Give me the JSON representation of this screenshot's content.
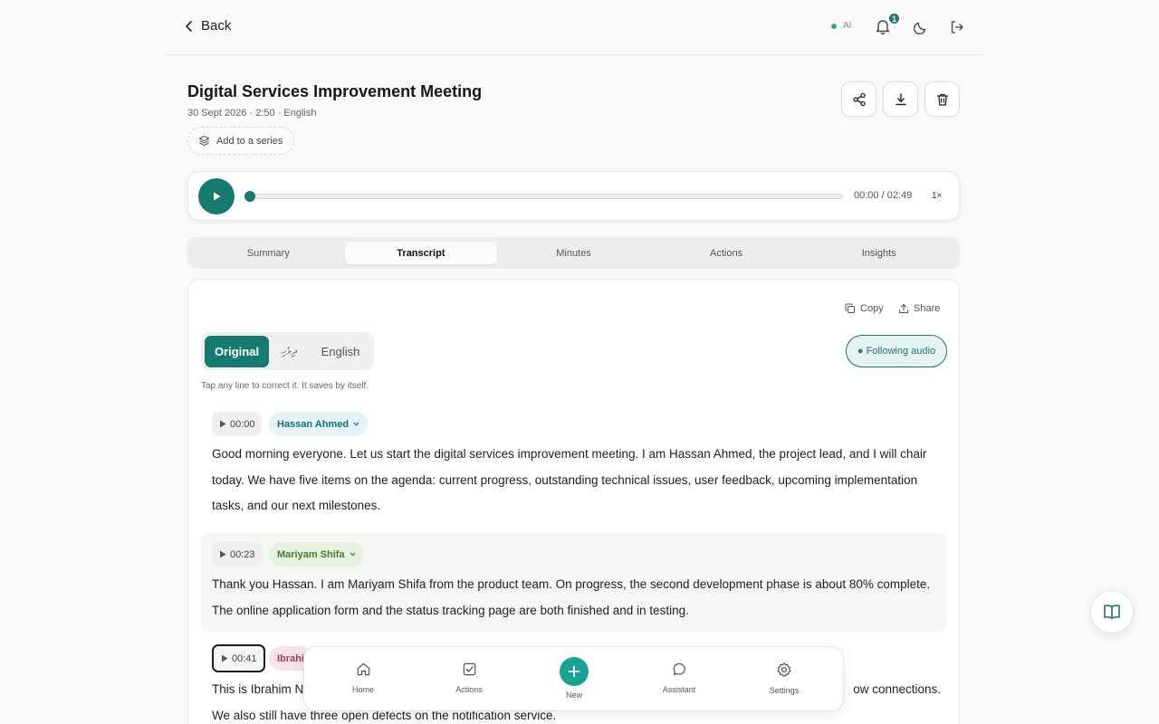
{
  "header": {
    "back_label": "Back",
    "ai_label": "AI",
    "notification_count": "1"
  },
  "meeting": {
    "title": "Digital Services Improvement Meeting",
    "meta": "30 Sept 2026 · 2:50 · English",
    "series_label": "Add to a series"
  },
  "player": {
    "time": "00:00 / 02:49",
    "speed": "1×",
    "progress": 0
  },
  "tabs": [
    {
      "label": "Summary",
      "active": false
    },
    {
      "label": "Transcript",
      "active": true
    },
    {
      "label": "Minutes",
      "active": false
    },
    {
      "label": "Actions",
      "active": false
    },
    {
      "label": "Insights",
      "active": false
    }
  ],
  "transcript": {
    "copy_label": "Copy",
    "share_label": "Share",
    "languages": [
      "Original",
      "ދިވެހި",
      "English"
    ],
    "active_language": "Original",
    "following_label": "● Following audio",
    "hint": "Tap any line to correct it. It saves by itself.",
    "segments": [
      {
        "time": "00:00",
        "speaker": "Hassan Ahmed",
        "text": "Good morning everyone. Let us start the digital services improvement meeting. I am Hassan Ahmed, the project lead, and I will chair today. We have five items on the agenda: current progress, outstanding technical issues, user feedback, upcoming implementation tasks, and our next milestones."
      },
      {
        "time": "00:23",
        "speaker": "Mariyam Shifa",
        "text": "Thank you Hassan. I am Mariyam Shifa from the product team. On progress, the second development phase is about 80% complete. The online application form and the status tracking page are both finished and in testing."
      },
      {
        "time": "00:41",
        "speaker": "Ibrahi",
        "text_line1": "This is Ibrahim Na",
        "text_line1_end": "ow connections.",
        "text_line2": "We also still have three open defects on the notification service."
      }
    ]
  },
  "bottom_nav": {
    "items": [
      "Home",
      "Actions",
      "New",
      "Assistant",
      "Settings"
    ]
  },
  "colors": {
    "accent": "#177a6f",
    "new_button": "#16a394"
  }
}
